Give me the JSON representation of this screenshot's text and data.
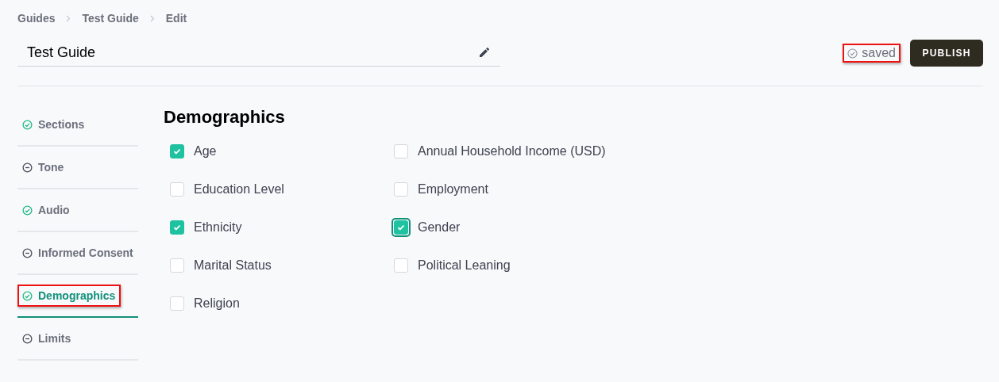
{
  "breadcrumbs": [
    {
      "label": "Guides"
    },
    {
      "label": "Test Guide"
    },
    {
      "label": "Edit"
    }
  ],
  "title_field": {
    "value": "Test Guide"
  },
  "save_status": {
    "label": "saved",
    "highlighted": true
  },
  "publish_button": {
    "label": "PUBLISH"
  },
  "sidebar": {
    "items": [
      {
        "label": "Sections",
        "kind": "complete",
        "selected": false,
        "highlighted": false
      },
      {
        "label": "Tone",
        "kind": "incomplete",
        "selected": false,
        "highlighted": false
      },
      {
        "label": "Audio",
        "kind": "complete",
        "selected": false,
        "highlighted": false
      },
      {
        "label": "Informed Consent",
        "kind": "incomplete",
        "selected": false,
        "highlighted": false
      },
      {
        "label": "Demographics",
        "kind": "complete",
        "selected": true,
        "highlighted": true
      },
      {
        "label": "Limits",
        "kind": "incomplete",
        "selected": false,
        "highlighted": false
      }
    ]
  },
  "section": {
    "heading": "Demographics",
    "options": [
      {
        "label": "Age",
        "checked": true,
        "focused": false
      },
      {
        "label": "Annual Household Income (USD)",
        "checked": false,
        "focused": false
      },
      {
        "label": "Education Level",
        "checked": false,
        "focused": false
      },
      {
        "label": "Employment",
        "checked": false,
        "focused": false
      },
      {
        "label": "Ethnicity",
        "checked": true,
        "focused": false
      },
      {
        "label": "Gender",
        "checked": true,
        "focused": true
      },
      {
        "label": "Marital Status",
        "checked": false,
        "focused": false
      },
      {
        "label": "Political Leaning",
        "checked": false,
        "focused": false
      },
      {
        "label": "Religion",
        "checked": false,
        "focused": false
      }
    ]
  }
}
